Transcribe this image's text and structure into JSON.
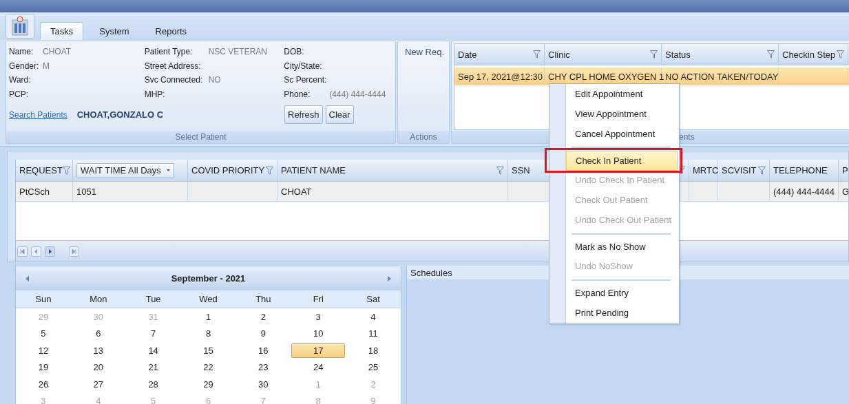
{
  "tabs": [
    {
      "label": "Tasks",
      "selected": true
    },
    {
      "label": "System",
      "selected": false
    },
    {
      "label": "Reports",
      "selected": false
    }
  ],
  "select_patient": {
    "columns": [
      [
        {
          "label": "Name:",
          "value": "CHOAT"
        },
        {
          "label": "Gender:",
          "value": "M"
        },
        {
          "label": "Ward:"
        },
        {
          "label": "PCP:"
        }
      ],
      [
        {
          "label": "Patient Type:",
          "value": "NSC VETERAN"
        },
        {
          "label": "Street Address:"
        },
        {
          "label": "Svc Connected:",
          "value": "NO"
        },
        {
          "label": "MHP:"
        }
      ],
      [
        {
          "label": "DOB:"
        },
        {
          "label": "City/State:"
        },
        {
          "label": "Sc Percent:"
        },
        {
          "label": "Phone:",
          "value": "(444) 444-4444"
        }
      ]
    ],
    "search_link": "Search Patients",
    "patient_name": "CHOAT,GONZALO C",
    "buttons": [
      "Refresh",
      "Clear"
    ],
    "group_label": "Select Patient"
  },
  "actions": {
    "buttons": [
      "New Req."
    ],
    "group_label": "Actions"
  },
  "appointments": {
    "columns": [
      {
        "label": "Date",
        "filter": true
      },
      {
        "label": "Clinic",
        "filter": true
      },
      {
        "label": "Status",
        "filter": true
      },
      {
        "label": "Checkin Step",
        "filter": true
      }
    ],
    "rows": [
      {
        "cells": [
          "Sep 17, 2021@12:30",
          "CHY CPL HOME OXYGEN 1",
          "NO ACTION TAKEN/TODAY",
          null
        ],
        "selected": true
      }
    ],
    "group_label_visible": "ents"
  },
  "request_grid": {
    "columns": [
      {
        "label": "REQUEST",
        "kind": "filter"
      },
      {
        "label": "WAIT TIME All Days",
        "kind": "dropdown"
      },
      {
        "label": "COVID PRIORITY",
        "kind": "filter"
      },
      {
        "label": "PATIENT NAME",
        "kind": "filter"
      },
      {
        "label": "SSN",
        "kind": "plain"
      },
      {
        "kind": "filter"
      },
      {
        "label": "MRTC",
        "kind": "plain"
      },
      {
        "label": "SCVISIT",
        "kind": "filter"
      },
      {
        "label": "TELEPHONE",
        "kind": "plain"
      },
      {
        "label": "P",
        "kind": "plain"
      }
    ],
    "rows": [
      {
        "cells": [
          "PtCSch",
          "1051",
          null,
          "CHOAT",
          null,
          null,
          null,
          null,
          "(444) 444-4444",
          "G"
        ]
      }
    ]
  },
  "calendar": {
    "month": "September - 2021",
    "weekdays": [
      "Sun",
      "Mon",
      "Tue",
      "Wed",
      "Thu",
      "Fri",
      "Sat"
    ],
    "weeks": [
      [
        {
          "day": "29",
          "other_month": true,
          "selected": false
        },
        {
          "day": "30",
          "other_month": true,
          "selected": false
        },
        {
          "day": "31",
          "other_month": true,
          "selected": false
        },
        {
          "day": "1",
          "other_month": false,
          "selected": false
        },
        {
          "day": "2",
          "other_month": false,
          "selected": false
        },
        {
          "day": "3",
          "other_month": false,
          "selected": false
        },
        {
          "day": "4",
          "other_month": false,
          "selected": false
        }
      ],
      [
        {
          "day": "5",
          "other_month": false,
          "selected": false
        },
        {
          "day": "6",
          "other_month": false,
          "selected": false
        },
        {
          "day": "7",
          "other_month": false,
          "selected": false
        },
        {
          "day": "8",
          "other_month": false,
          "selected": false
        },
        {
          "day": "9",
          "other_month": false,
          "selected": false
        },
        {
          "day": "10",
          "other_month": false,
          "selected": false
        },
        {
          "day": "11",
          "other_month": false,
          "selected": false
        }
      ],
      [
        {
          "day": "12",
          "other_month": false,
          "selected": false
        },
        {
          "day": "13",
          "other_month": false,
          "selected": false
        },
        {
          "day": "14",
          "other_month": false,
          "selected": false
        },
        {
          "day": "15",
          "other_month": false,
          "selected": false
        },
        {
          "day": "16",
          "other_month": false,
          "selected": false
        },
        {
          "day": "17",
          "other_month": false,
          "selected": true
        },
        {
          "day": "18",
          "other_month": false,
          "selected": false
        }
      ],
      [
        {
          "day": "19",
          "other_month": false,
          "selected": false
        },
        {
          "day": "20",
          "other_month": false,
          "selected": false
        },
        {
          "day": "21",
          "other_month": false,
          "selected": false
        },
        {
          "day": "22",
          "other_month": false,
          "selected": false
        },
        {
          "day": "23",
          "other_month": false,
          "selected": false
        },
        {
          "day": "24",
          "other_month": false,
          "selected": false
        },
        {
          "day": "25",
          "other_month": false,
          "selected": false
        }
      ],
      [
        {
          "day": "26",
          "other_month": false,
          "selected": false
        },
        {
          "day": "27",
          "other_month": false,
          "selected": false
        },
        {
          "day": "28",
          "other_month": false,
          "selected": false
        },
        {
          "day": "29",
          "other_month": false,
          "selected": false
        },
        {
          "day": "30",
          "other_month": false,
          "selected": false
        },
        {
          "day": "1",
          "other_month": true,
          "selected": false
        },
        {
          "day": "2",
          "other_month": true,
          "selected": false
        }
      ],
      [
        {
          "day": "3",
          "other_month": true,
          "selected": false
        },
        {
          "day": "4",
          "other_month": true,
          "selected": false
        },
        {
          "day": "5",
          "other_month": true,
          "selected": false
        },
        {
          "day": "6",
          "other_month": true,
          "selected": false
        },
        {
          "day": "7",
          "other_month": true,
          "selected": false
        },
        {
          "day": "8",
          "other_month": true,
          "selected": false
        },
        {
          "day": "9",
          "other_month": true,
          "selected": false
        }
      ]
    ]
  },
  "schedules": {
    "title": "Schedules"
  },
  "context_menu": [
    {
      "kind": "item",
      "label": "Edit Appointment",
      "disabled": false,
      "selected": false,
      "framed": false
    },
    {
      "kind": "item",
      "label": "View Appointment",
      "disabled": false,
      "selected": false,
      "framed": false
    },
    {
      "kind": "item",
      "label": "Cancel Appointment",
      "disabled": false,
      "selected": false,
      "framed": false
    },
    {
      "kind": "separator"
    },
    {
      "kind": "item",
      "label": "Check In Patient",
      "disabled": false,
      "selected": true,
      "framed": true
    },
    {
      "kind": "item",
      "label": "Undo Check In Patient",
      "disabled": true,
      "selected": false,
      "framed": false
    },
    {
      "kind": "item",
      "label": "Check Out Patient",
      "disabled": true,
      "selected": false,
      "framed": false
    },
    {
      "kind": "item",
      "label": "Undo Check Out Patient",
      "disabled": true,
      "selected": false,
      "framed": false
    },
    {
      "kind": "separator"
    },
    {
      "kind": "item",
      "label": "Mark as No Show",
      "disabled": false,
      "selected": false,
      "framed": false
    },
    {
      "kind": "item",
      "label": "Undo NoShow",
      "disabled": true,
      "selected": false,
      "framed": false
    },
    {
      "kind": "separator"
    },
    {
      "kind": "item",
      "label": "Expand Entry",
      "disabled": false,
      "selected": false,
      "framed": false
    },
    {
      "kind": "item",
      "label": "Print Pending",
      "disabled": false,
      "selected": false,
      "framed": false
    }
  ]
}
